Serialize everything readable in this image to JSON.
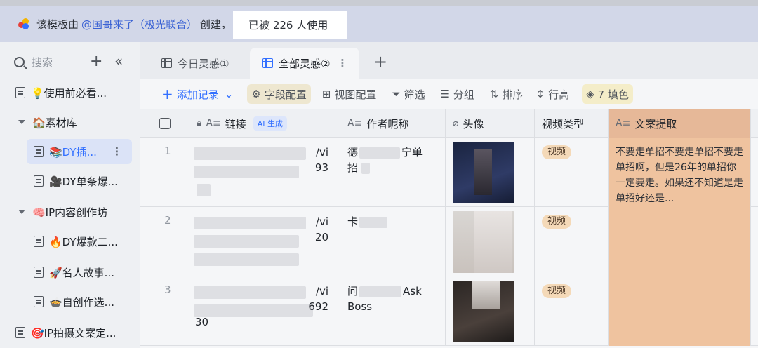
{
  "banner": {
    "prefix": "该模板由",
    "creator": "@国哥来了（极光联合）",
    "suffix": "创建，",
    "usage": "已被 226 人使用"
  },
  "sidebar": {
    "search_placeholder": "搜索",
    "items": [
      {
        "label": "💡使用前必看..."
      },
      {
        "label": "🏠素材库"
      },
      {
        "label": "📚DY插..."
      },
      {
        "label": "🎥DY单条爆..."
      },
      {
        "label": "🧠IP内容创作坊"
      },
      {
        "label": "🔥DY爆款二..."
      },
      {
        "label": "🚀名人故事..."
      },
      {
        "label": "🍲自创作选..."
      },
      {
        "label": "🎯IP拍摄文案定..."
      }
    ]
  },
  "tabs": [
    {
      "label": "今日灵感①"
    },
    {
      "label": "全部灵感②"
    }
  ],
  "toolbar": {
    "add_record": "添加记录",
    "field_config": "字段配置",
    "view_config": "视图配置",
    "filter": "筛选",
    "group": "分组",
    "sort": "排序",
    "row_height": "行高",
    "fill": "7 填色"
  },
  "table": {
    "headers": {
      "link": "链接",
      "ai_tag": "AI 生成",
      "author": "作者昵称",
      "avatar": "头像",
      "video_type": "视频类型",
      "copy_extract": "文案提取"
    },
    "rows": [
      {
        "index": "1",
        "link_tail_1": "/vi",
        "link_tail_2": "93",
        "author_1": "德",
        "author_2": "宁单",
        "author_3": "招",
        "video_type": "视频",
        "copy_extract": "不要走单招不要走单招不要走单招啊，但是26年的单招你一定要走。如果还不知道是走单招好还是..."
      },
      {
        "index": "2",
        "link_tail_1": "/vi",
        "link_tail_2": "20",
        "author_1": "卡",
        "author_2": "",
        "author_3": "",
        "video_type": "视频",
        "copy_extract": ""
      },
      {
        "index": "3",
        "link_tail_1": "/vi",
        "link_tail_2": "692",
        "link_tail_3": "30",
        "author_1": "问",
        "author_2": "Ask",
        "author_3": "Boss",
        "video_type": "视频",
        "copy_extract": ""
      }
    ]
  },
  "colors": {
    "accent_blue": "#3370ff",
    "banner_bg": "#d2d7e8",
    "column_accent": "#efc39f",
    "tag_bg": "#f4d9b8"
  }
}
